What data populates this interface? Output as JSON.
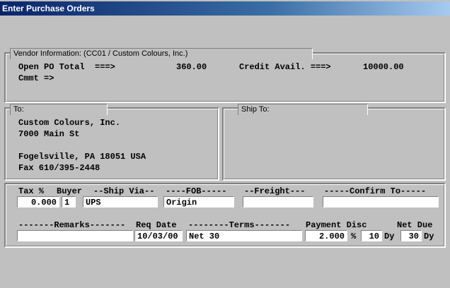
{
  "window": {
    "title": "Enter Purchase Orders"
  },
  "vendor": {
    "section_label": "Vendor Information: (CC01 / Custom Colours, Inc.)",
    "open_po_label": "Open PO Total  ===>",
    "open_po_value": "360.00",
    "credit_label": "Credit Avail. ===>",
    "credit_value": "10000.00",
    "cmmt_label": "Cmmt =>"
  },
  "to": {
    "section_label": "To:",
    "line1": "Custom Colours, Inc.",
    "line2": "7000 Main St",
    "line3": "Fogelsville, PA 18051 USA",
    "line4": "Fax 610/395-2448"
  },
  "ship_to": {
    "section_label": "Ship To:"
  },
  "order": {
    "headers": {
      "tax": "Tax %",
      "buyer": "Buyer",
      "ship_via": "--Ship Via--",
      "fob": "----FOB-----",
      "freight": "--Freight---",
      "confirm_to": "-----Confirm To-----",
      "remarks": "-------Remarks-------",
      "req_date": "Req Date",
      "terms": "--------Terms-------",
      "payment_disc": "Payment Disc",
      "net_due": "Net Due"
    },
    "values": {
      "tax": "0.000",
      "buyer": "1",
      "ship_via": "UPS",
      "fob": "Origin",
      "freight": "",
      "confirm_to": "",
      "remarks": "",
      "req_date": "10/03/00",
      "terms": "Net 30",
      "payment_disc": "2.000",
      "disc_days": "10",
      "net_days": "30"
    },
    "suffix": {
      "percent": "%",
      "dy1": "Dy",
      "dy2": "Dy"
    }
  }
}
